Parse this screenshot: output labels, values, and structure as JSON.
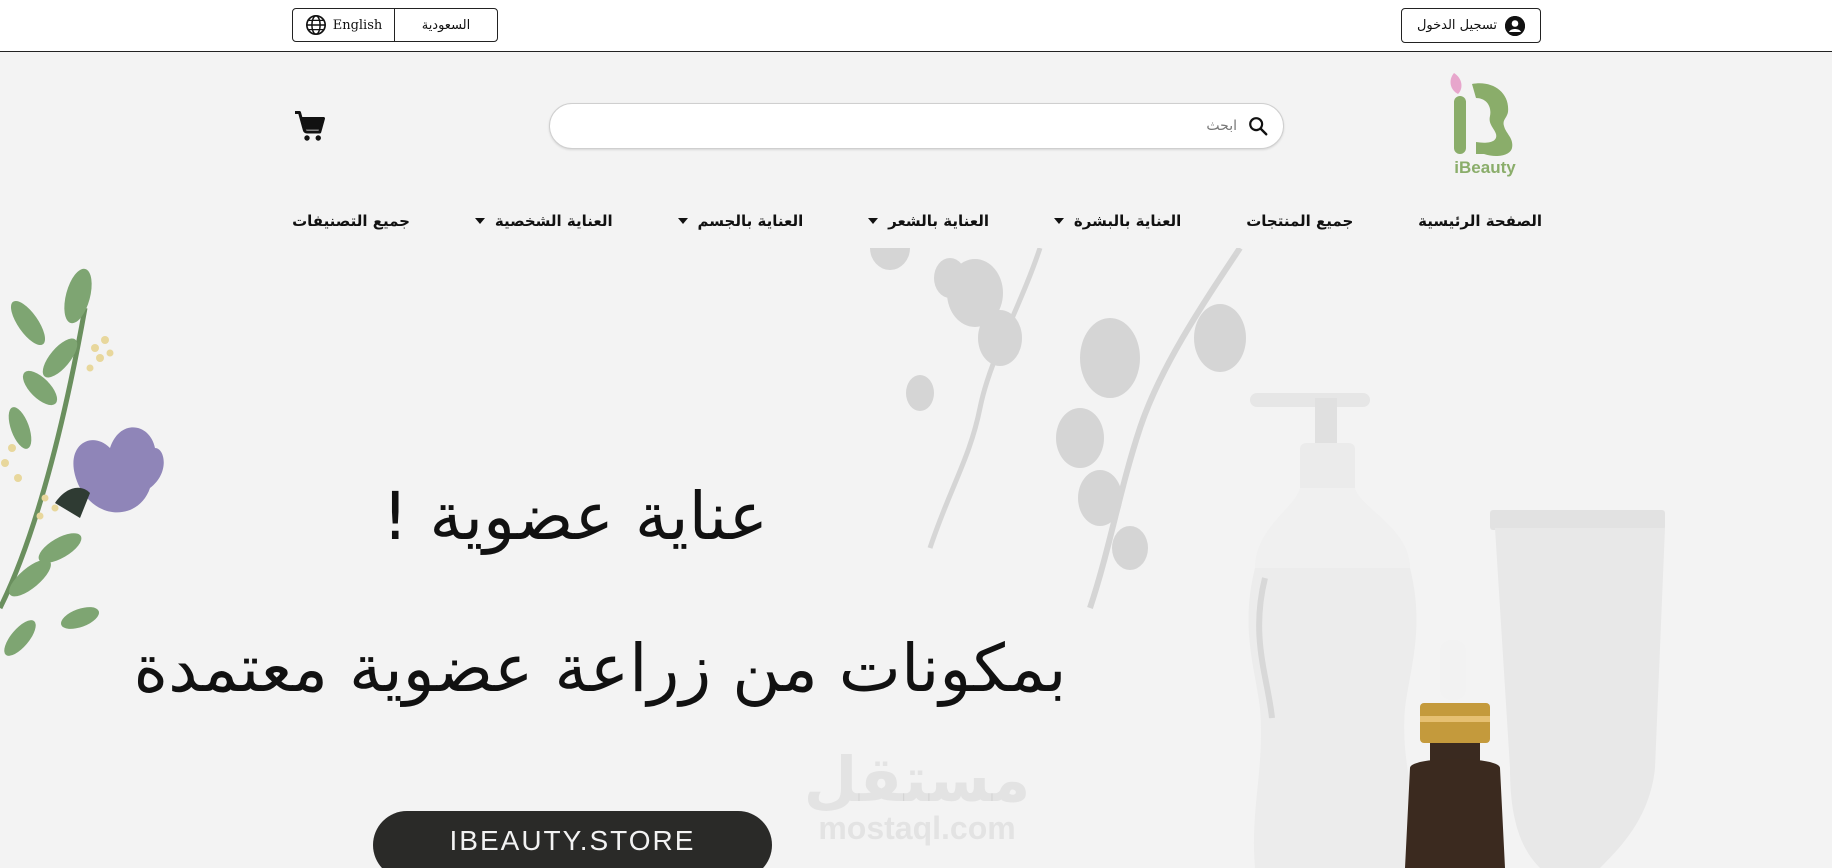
{
  "topbar": {
    "language_label": "English",
    "country_label": "السعودية",
    "login_label": "تسجيل الدخول"
  },
  "header": {
    "logo_text": "iBeauty",
    "search_placeholder": "ابحث"
  },
  "nav": {
    "items": [
      {
        "label": "الصفحة الرئيسية",
        "has_dropdown": false
      },
      {
        "label": "جميع المنتجات",
        "has_dropdown": false
      },
      {
        "label": "العناية بالبشرة",
        "has_dropdown": true
      },
      {
        "label": "العناية بالشعر",
        "has_dropdown": true
      },
      {
        "label": "العناية بالجسم",
        "has_dropdown": true
      },
      {
        "label": "العناية الشخصية",
        "has_dropdown": true
      },
      {
        "label": "جميع التصنيفات",
        "has_dropdown": false
      }
    ]
  },
  "hero": {
    "title": "عناية عضوية !",
    "subtitle": "بمكونات من زراعة عضوية معتمدة",
    "button_label": "IBEAUTY.STORE",
    "watermark_ar": "مستقل",
    "watermark_en": "mostaql.com"
  },
  "colors": {
    "brand_green": "#8aad6a",
    "brand_pink": "#e7a6cc",
    "background": "#f3f3f3",
    "dark_button": "#2a2a28"
  },
  "icons": {
    "language": "globe-icon",
    "login": "user-circle-icon",
    "search": "search-icon",
    "cart": "cart-icon",
    "dropdown": "caret-down-icon"
  }
}
